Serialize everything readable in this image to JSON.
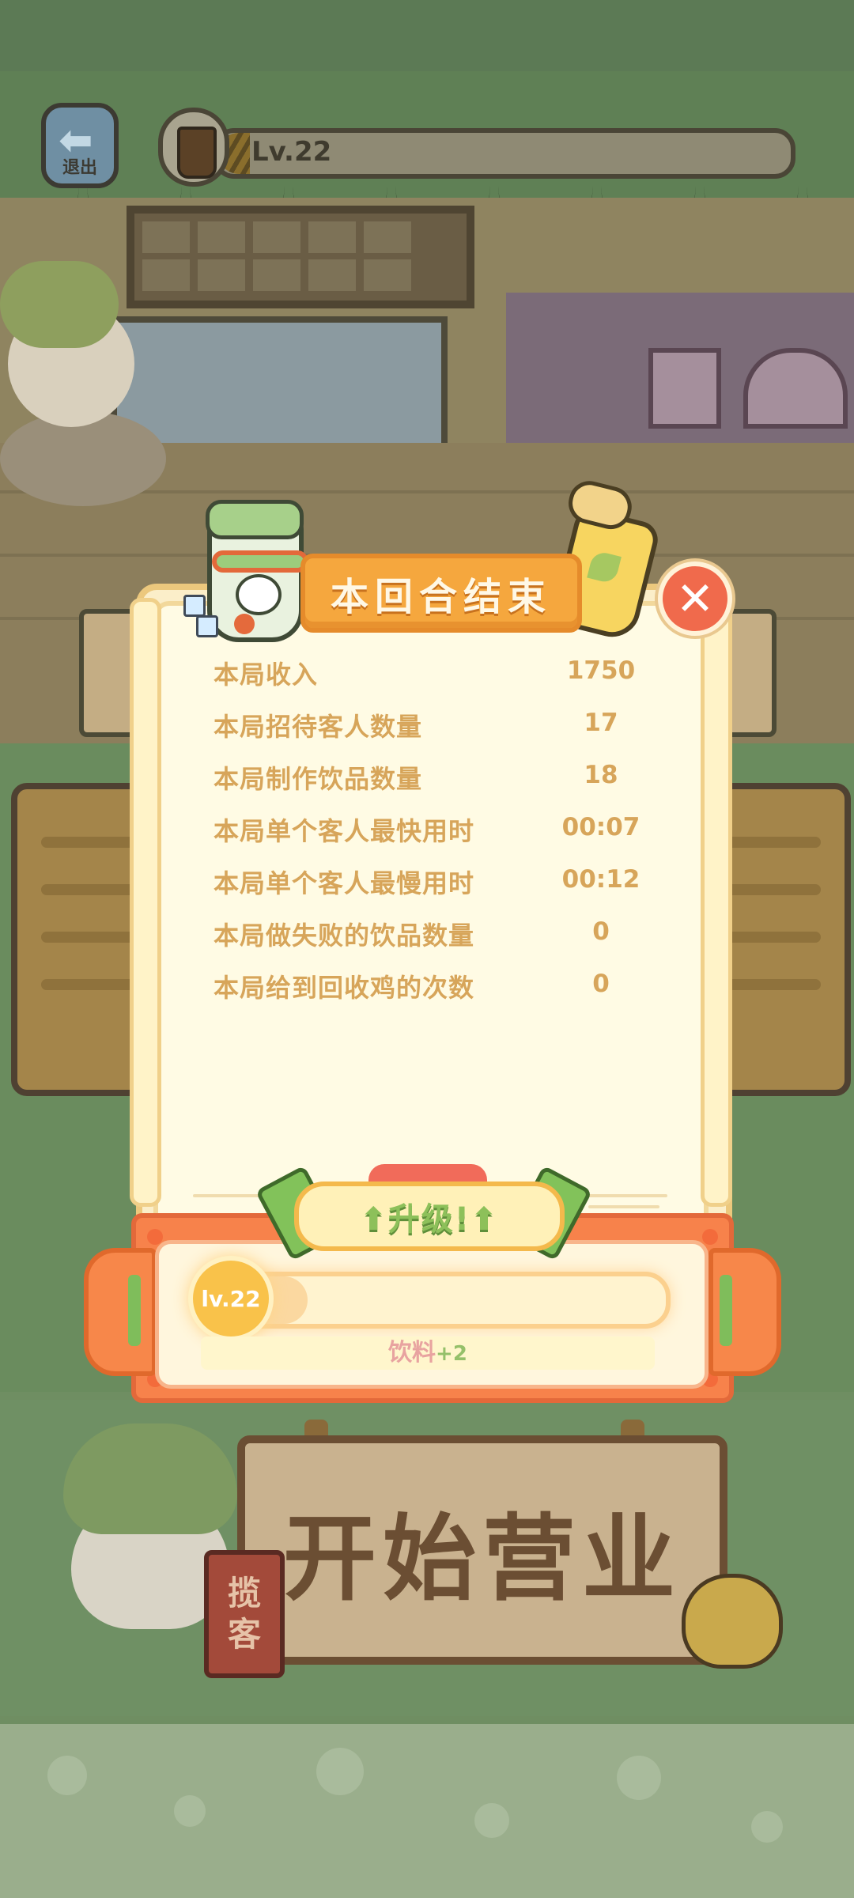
{
  "hud": {
    "exit_label": "退出",
    "level_text": "Lv.22"
  },
  "background": {
    "sign_text": "开始营业",
    "tag_text": [
      "揽",
      "客"
    ]
  },
  "popup": {
    "title": "本回合结束",
    "stats": [
      {
        "label": "本局收入",
        "value": "1750"
      },
      {
        "label": "本局招待客人数量",
        "value": "17"
      },
      {
        "label": "本局制作饮品数量",
        "value": "18"
      },
      {
        "label": "本局单个客人最快用时",
        "value": "00:07"
      },
      {
        "label": "本局单个客人最慢用时",
        "value": "00:12"
      },
      {
        "label": "本局做失败的饮品数量",
        "value": "0"
      },
      {
        "label": "本局给到回收鸡的次数",
        "value": "0"
      }
    ],
    "upgrade_label": "⬆升级!⬆",
    "level_badge": "lv.22",
    "exp_progress": 0.2,
    "reward_label": "饮料",
    "reward_amount": "+2",
    "close_icon": "close-icon"
  },
  "colors": {
    "accent_orange": "#f5a73e",
    "close_red": "#f06a4c",
    "stat_text": "#d7a55a",
    "band_orange": "#f7824b"
  }
}
